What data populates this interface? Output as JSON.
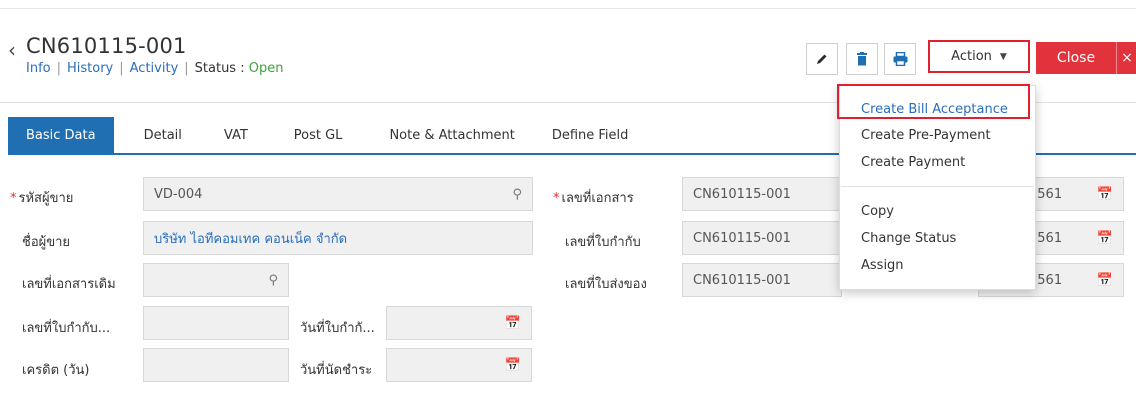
{
  "header": {
    "title": "CN610115-001",
    "subnav": {
      "info": "Info",
      "history": "History",
      "activity": "Activity",
      "status_label": "Status",
      "status_colon": ":",
      "status_value": "Open"
    }
  },
  "toolbar": {
    "action_label": "Action",
    "close_label": "Close",
    "x_label": "×"
  },
  "tabs": [
    {
      "label": "Basic Data"
    },
    {
      "label": "Detail"
    },
    {
      "label": "VAT"
    },
    {
      "label": "Post GL"
    },
    {
      "label": "Note & Attachment"
    },
    {
      "label": "Define Field"
    }
  ],
  "form": {
    "vendor_code": {
      "label": "รหัสผู้ขาย",
      "value": "VD-004"
    },
    "vendor_name": {
      "label": "ชื่อผู้ขาย",
      "value": "บริษัท ไอทีคอมเทค คอนเน็ค จำกัด"
    },
    "ref_doc": {
      "label": "เลขที่เอกสารเดิม",
      "value": ""
    },
    "tax_inv_no": {
      "label": "เลขที่ใบกำกับ...",
      "value": ""
    },
    "tax_inv_date": {
      "label": "วันที่ใบกำกั...",
      "value": ""
    },
    "credit": {
      "label": "เครดิต (วัน)",
      "value": ""
    },
    "due_date": {
      "label": "วันที่นัดชำระ",
      "value": ""
    },
    "doc_no": {
      "label": "เลขที่เอกสาร",
      "value": "CN610115-001"
    },
    "tax_no": {
      "label": "เลขที่ใบกำกับ",
      "value": "CN610115-001"
    },
    "delivery_no": {
      "label": "เลขที่ใบส่งของ",
      "value": "CN610115-001"
    },
    "date1": "2561",
    "date2": "2561",
    "date3": "2561"
  },
  "action_menu": {
    "items": [
      "Create Bill Acceptance",
      "Create Pre-Payment",
      "Create Payment",
      "Copy",
      "Change Status",
      "Assign"
    ]
  },
  "colors": {
    "accent": "#1f6fb2",
    "close": "#e2333d",
    "highlight": "#e0202e",
    "status_open": "#3ca23c",
    "link": "#2a6ebb"
  }
}
